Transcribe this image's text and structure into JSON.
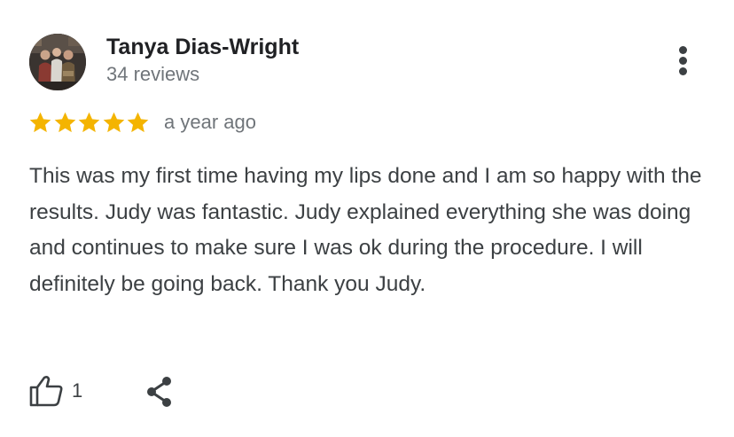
{
  "review": {
    "reviewer_name": "Tanya Dias-Wright",
    "review_count": "34 reviews",
    "rating": 5,
    "max_rating": 5,
    "time": "a year ago",
    "text": "This was my first time having my lips done and I am so happy with the results. Judy was fantastic. Judy explained everything she was doing and continues to make sure I was ok during the procedure. I will definitely be going back. Thank you Judy.",
    "like_count": "1"
  },
  "icons": {
    "more": "more-vert-icon",
    "like": "thumbs-up-icon",
    "share": "share-icon",
    "star": "star-icon"
  },
  "colors": {
    "star": "#f4b400",
    "name": "#202124",
    "secondary_text": "#70757a",
    "body_text": "#3c4043"
  }
}
